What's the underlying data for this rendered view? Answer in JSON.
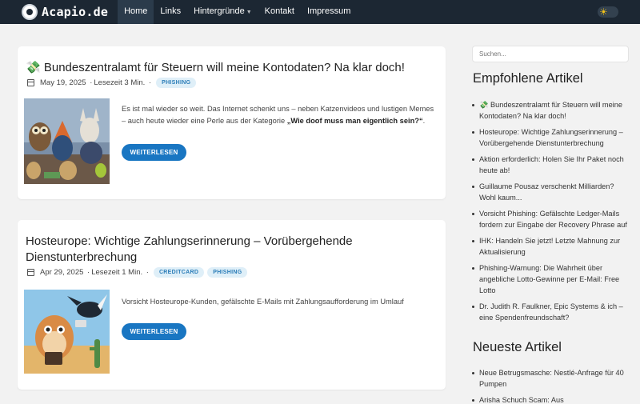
{
  "brand": {
    "name": "Acapio.de"
  },
  "nav": {
    "home": "Home",
    "links": "Links",
    "background": "Hintergründe",
    "contact": "Kontakt",
    "imprint": "Impressum"
  },
  "posts": [
    {
      "title": "💸 Bundeszentralamt für Steuern will meine Kontodaten? Na klar doch!",
      "date": "May 19, 2025",
      "read_time": "Lesezeit 3 Min.",
      "badges": [
        "PHISHING"
      ],
      "excerpt_before": "Es ist mal wieder so weit. Das Internet schenkt uns – neben Katzenvideos und lustigen Memes – auch heute wieder eine Perle aus der Kategorie ",
      "excerpt_bold": "„Wie doof muss man eigentlich sein?“",
      "excerpt_after": ".",
      "button": "WEITERLESEN"
    },
    {
      "title": "Hosteurope: Wichtige Zahlungserinnerung – Vorübergehende Dienstunterbrechung",
      "date": "Apr 29, 2025",
      "read_time": "Lesezeit 1 Min.",
      "badges": [
        "CREDITCARD",
        "PHISHING"
      ],
      "excerpt": "Vorsicht Hosteurope-Kunden, gefälschte E-Mails mit Zahlungsaufforderung im Umlauf",
      "button": "WEITERLESEN"
    }
  ],
  "sidebar": {
    "search_placeholder": "Suchen...",
    "recommended_heading": "Empfohlene Artikel",
    "recommended": [
      "💸 Bundeszentralamt für Steuern will meine Kontodaten? Na klar doch!",
      "Hosteurope: Wichtige Zahlungserinnerung – Vorübergehende Dienstunterbrechung",
      "Aktion erforderlich: Holen Sie Ihr Paket noch heute ab!",
      "Guillaume Pousaz verschenkt Milliarden? Wohl kaum...",
      "Vorsicht Phishing: Gefälschte Ledger-Mails fordern zur Eingabe der Recovery Phrase auf",
      "IHK: Handeln Sie jetzt! Letzte Mahnung zur Aktualisierung",
      "Phishing-Warnung: Die Wahrheit über angebliche Lotto-Gewinne per E-Mail: Free Lotto",
      "Dr. Judith R. Faulkner, Epic Systems & ich – eine Spendenfreundschaft?"
    ],
    "newest_heading": "Neueste Artikel",
    "newest": [
      "Neue Betrugsmasche: Nestlé-Anfrage für 40 Pumpen",
      "Arisha Schuch Scam: Aus"
    ]
  },
  "colors": {
    "navbar": "#1c2733",
    "accent": "#1976c2",
    "badge_bg": "#dfeff8",
    "badge_text": "#2b7db8"
  }
}
